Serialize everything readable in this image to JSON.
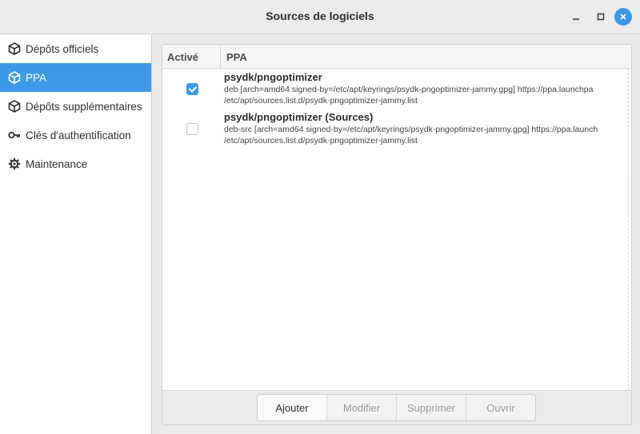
{
  "window": {
    "title": "Sources de logiciels"
  },
  "sidebar": {
    "items": [
      {
        "label": "Dépôts officiels",
        "icon": "package-icon"
      },
      {
        "label": "PPA",
        "icon": "package-icon"
      },
      {
        "label": "Dépôts supplémentaires",
        "icon": "package-icon"
      },
      {
        "label": "Clés d'authentification",
        "icon": "key-icon"
      },
      {
        "label": "Maintenance",
        "icon": "gear-icon"
      }
    ],
    "selected": "PPA"
  },
  "table": {
    "headers": {
      "active": "Activé",
      "ppa": "PPA"
    },
    "rows": [
      {
        "enabled": true,
        "title": "psydk/pngoptimizer",
        "line1": "deb [arch=amd64 signed-by=/etc/apt/keyrings/psydk-pngoptimizer-jammy.gpg] https://ppa.launchpa",
        "line2": "/etc/apt/sources.list.d/psydk-pngoptimizer-jammy.list"
      },
      {
        "enabled": false,
        "title": "psydk/pngoptimizer (Sources)",
        "line1": "deb-src [arch=amd64 signed-by=/etc/apt/keyrings/psydk-pngoptimizer-jammy.gpg] https://ppa.launch",
        "line2": "/etc/apt/sources.list.d/psydk-pngoptimizer-jammy.list"
      }
    ]
  },
  "buttons": {
    "add": "Ajouter",
    "edit": "Modifier",
    "remove": "Supprimer",
    "open": "Ouvrir"
  },
  "colors": {
    "accent": "#3d9ae8"
  }
}
